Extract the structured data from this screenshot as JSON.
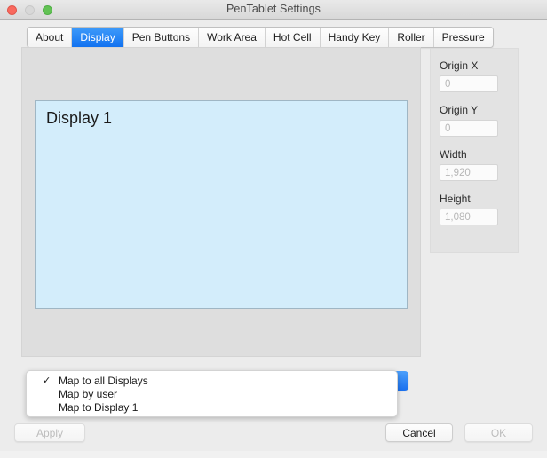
{
  "window": {
    "title": "PenTablet Settings",
    "traffic_lights": [
      "close-button",
      "minimize-button",
      "zoom-button"
    ]
  },
  "tabs": [
    {
      "label": "About",
      "selected": false
    },
    {
      "label": "Display",
      "selected": true
    },
    {
      "label": "Pen Buttons",
      "selected": false
    },
    {
      "label": "Work Area",
      "selected": false
    },
    {
      "label": "Hot Cell",
      "selected": false
    },
    {
      "label": "Handy Key",
      "selected": false
    },
    {
      "label": "Roller",
      "selected": false
    },
    {
      "label": "Pressure",
      "selected": false
    }
  ],
  "display_area": {
    "display_label": "Display 1",
    "fill_color": "#d3edfb",
    "border_color": "#9fb6c4"
  },
  "fields": [
    {
      "label": "Origin X",
      "value": "0",
      "enabled": false
    },
    {
      "label": "Origin Y",
      "value": "0",
      "enabled": false
    },
    {
      "label": "Width",
      "value": "1,920",
      "enabled": false
    },
    {
      "label": "Height",
      "value": "1,080",
      "enabled": false
    }
  ],
  "mapping_menu": {
    "open": true,
    "checkmark": "✓",
    "items": [
      {
        "label": "Map to all Displays",
        "checked": true
      },
      {
        "label": "Map by user",
        "checked": false
      },
      {
        "label": "Map to Display 1",
        "checked": false
      }
    ]
  },
  "buttons": {
    "apply": {
      "label": "Apply",
      "enabled": false
    },
    "cancel": {
      "label": "Cancel",
      "enabled": true
    },
    "ok": {
      "label": "OK",
      "enabled": false
    }
  },
  "colors": {
    "accent_blue": "#1272f0",
    "window_bg": "#ececec",
    "panel_bg": "#dedede",
    "field_panel_bg": "#e3e3e3"
  }
}
